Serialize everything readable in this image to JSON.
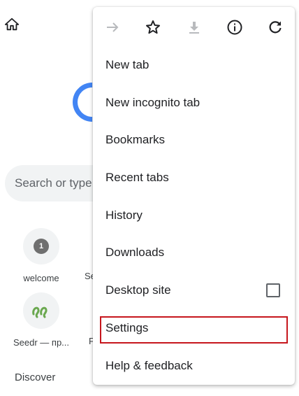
{
  "background": {
    "search_placeholder": "Search or type",
    "tiles": [
      {
        "label": "welcome",
        "badge": "1"
      },
      {
        "label": "Seedr — пр..."
      }
    ],
    "partial_labels": [
      "Se",
      "F"
    ],
    "discover_label": "Discover"
  },
  "menu": {
    "toolbar": [
      {
        "icon": "forward-arrow-icon",
        "enabled": false
      },
      {
        "icon": "star-icon",
        "enabled": true
      },
      {
        "icon": "download-icon",
        "enabled": false
      },
      {
        "icon": "info-icon",
        "enabled": true
      },
      {
        "icon": "reload-icon",
        "enabled": true
      }
    ],
    "items": [
      {
        "label": "New tab"
      },
      {
        "label": "New incognito tab"
      },
      {
        "label": "Bookmarks"
      },
      {
        "label": "Recent tabs"
      },
      {
        "label": "History"
      },
      {
        "label": "Downloads"
      },
      {
        "label": "Desktop site",
        "checkbox": false
      },
      {
        "label": "Settings",
        "highlighted": true
      },
      {
        "label": "Help & feedback"
      }
    ]
  },
  "colors": {
    "highlight_border": "#c6161d",
    "logo_blue": "#4285f4",
    "seedr_green": "#6aa84f"
  }
}
